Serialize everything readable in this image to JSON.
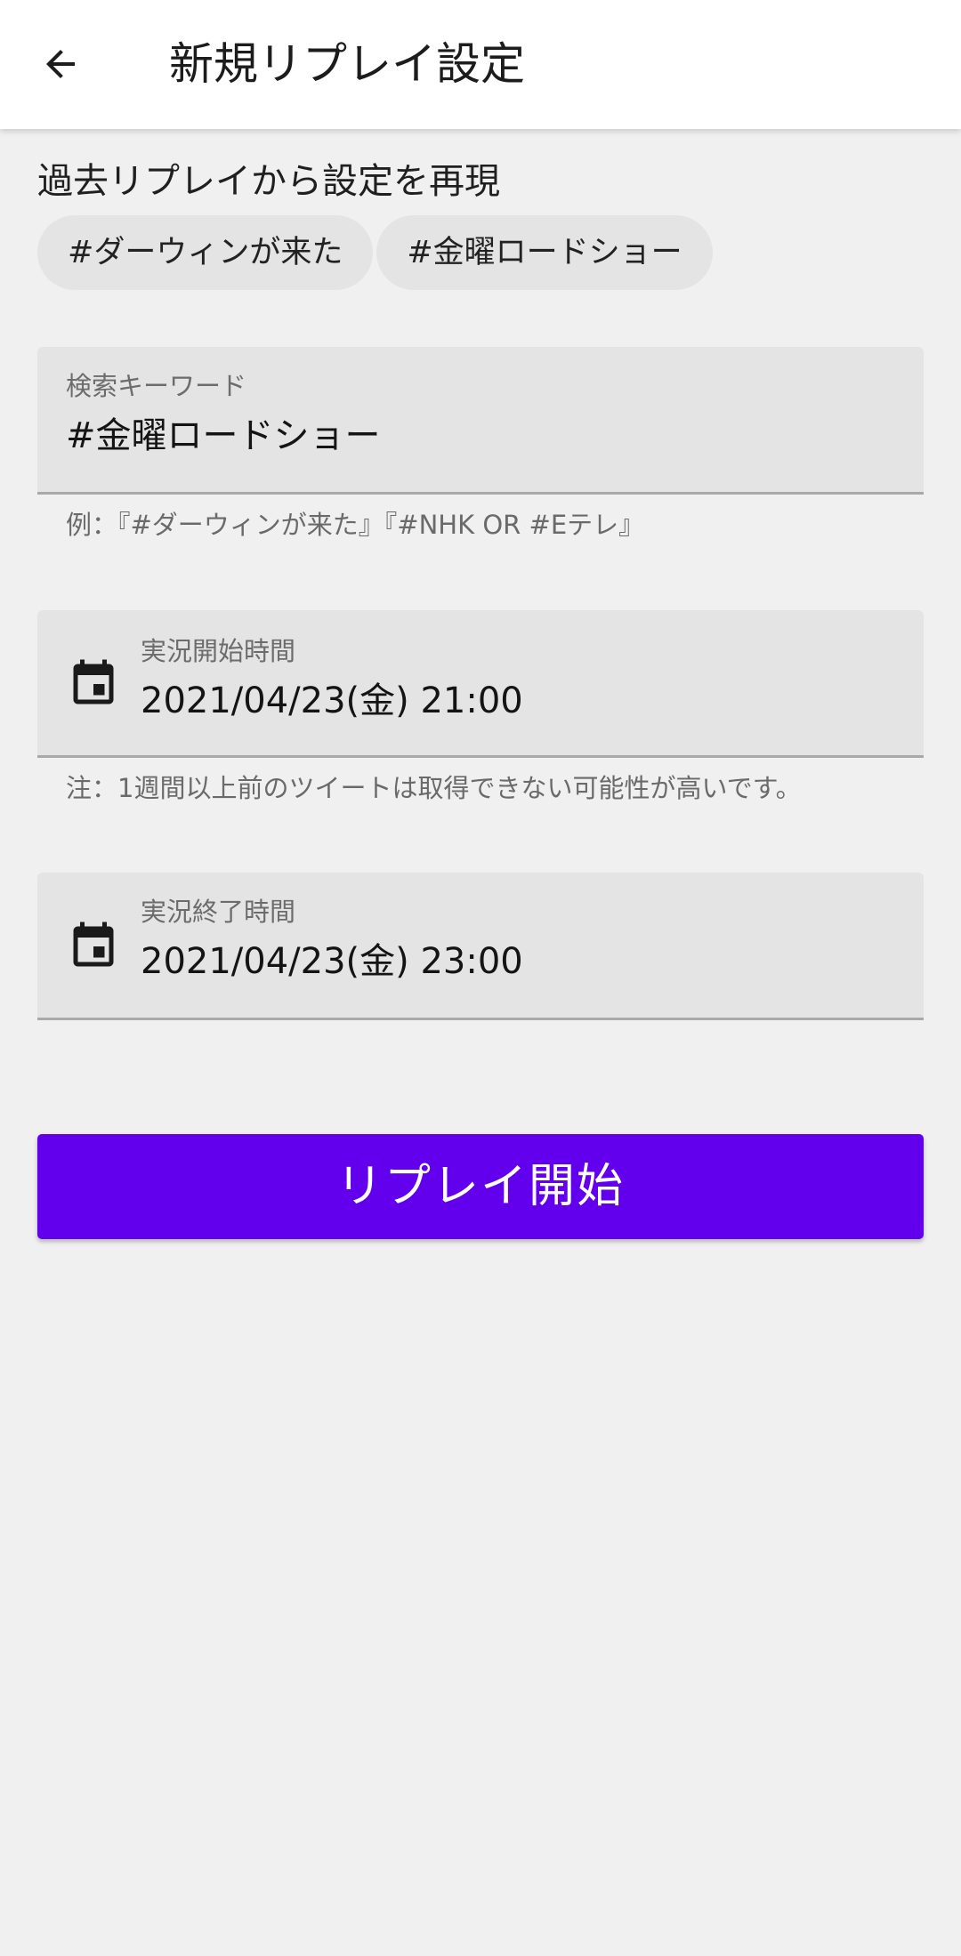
{
  "appbar": {
    "title": "新規リプレイ設定",
    "back_icon": "arrow-back-icon"
  },
  "history": {
    "title": "過去リプレイから設定を再現",
    "chips": [
      "#ダーウィンが来た",
      "#金曜ロードショー"
    ]
  },
  "keyword": {
    "label": "検索キーワード",
    "value": "#金曜ロードショー",
    "helper": "例：『#ダーウィンが来た』『#NHK OR #Eテレ』"
  },
  "start_time": {
    "label": "実況開始時間",
    "value": "2021/04/23(金) 21:00",
    "helper": "注：1週間以上前のツイートは取得できない可能性が高いです。",
    "icon": "calendar-icon"
  },
  "end_time": {
    "label": "実況終了時間",
    "value": "2021/04/23(金) 23:00",
    "icon": "calendar-icon"
  },
  "action": {
    "label": "リプレイ開始"
  },
  "colors": {
    "primary": "#6200ee",
    "background": "#f0f0f0",
    "field_fill": "#e4e4e4",
    "appbar": "#ffffff"
  }
}
